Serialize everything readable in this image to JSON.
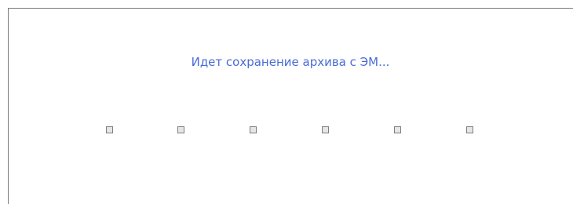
{
  "dialog": {
    "status_text": "Идет сохранение архива с ЭМ...",
    "progress_indicators": [
      {
        "state": "inactive"
      },
      {
        "state": "inactive"
      },
      {
        "state": "inactive"
      },
      {
        "state": "inactive"
      },
      {
        "state": "inactive"
      },
      {
        "state": "inactive"
      }
    ]
  },
  "colors": {
    "status_text": "#4a6cd4",
    "indicator_border": "#7d7d7d",
    "indicator_fill": "#e6e6e6",
    "background": "#ffffff"
  }
}
